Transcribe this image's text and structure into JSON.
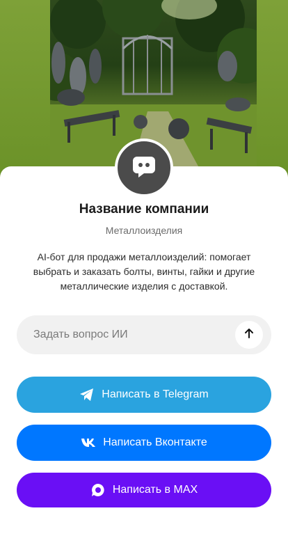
{
  "hero": {
    "image": "garden-with-metal-sculptures-image"
  },
  "company": {
    "name": "Название компании",
    "category": "Металлоизделия",
    "description": "AI-бот для продажи металлоизделий: помогает выбрать и заказать болты, винты, гайки и другие металлические изделия с доставкой.",
    "avatar_icon": "chat-bot-icon"
  },
  "ask": {
    "placeholder": "Задать вопрос ИИ",
    "send_icon": "arrow-up-icon"
  },
  "buttons": {
    "telegram": {
      "label": "Написать в Telegram",
      "icon": "telegram-icon",
      "color": "#2aa3df"
    },
    "vk": {
      "label": "Написать Вконтакте",
      "icon": "vk-icon",
      "color": "#0077ff"
    },
    "max": {
      "label": "Написать в MAX",
      "icon": "max-icon",
      "color": "#6a0ff5"
    }
  },
  "colors": {
    "background": "#6f9a2e",
    "card": "#ffffff",
    "avatar": "#4b4b4b"
  }
}
